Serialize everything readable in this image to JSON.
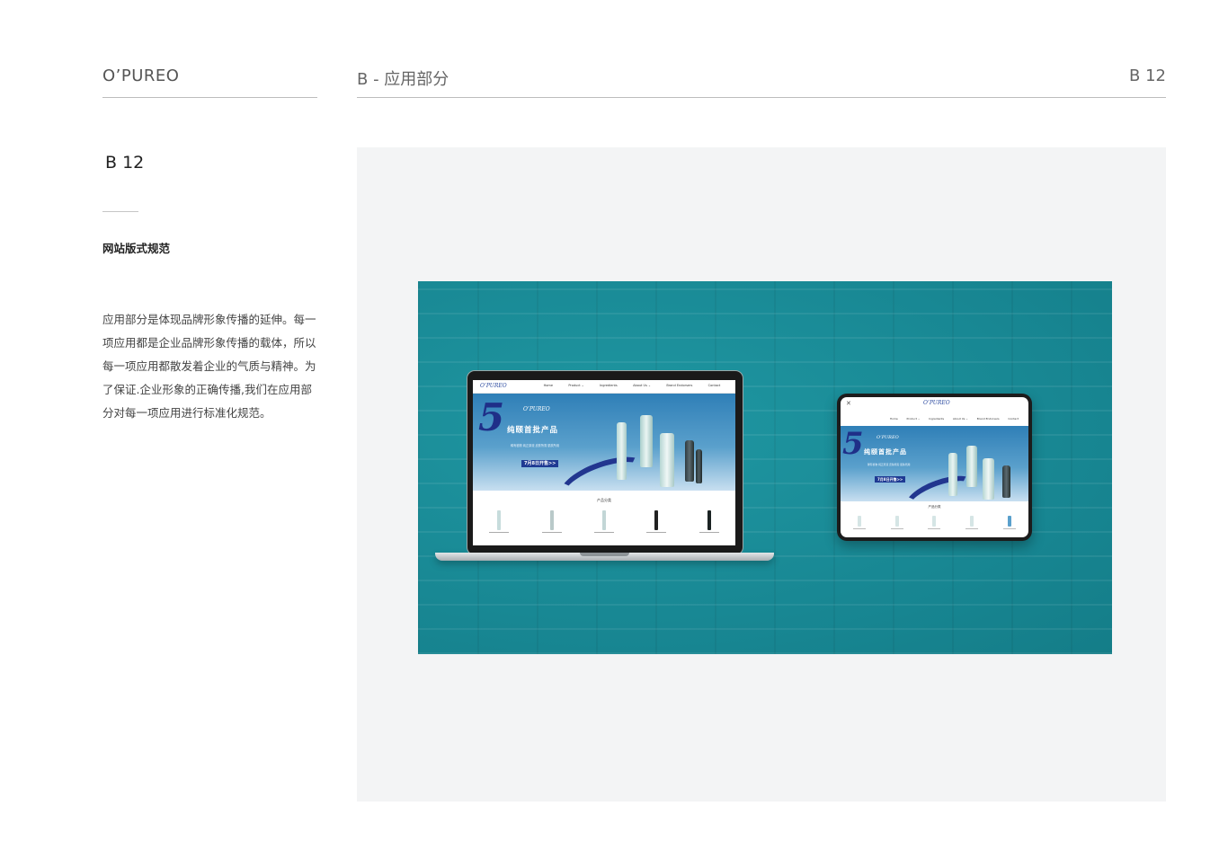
{
  "header": {
    "brand": "O’PUREO",
    "section_title": "B - 应用部分",
    "page_number": "B 12"
  },
  "sidebar": {
    "code": "B 12",
    "subtitle": "网站版式规范",
    "description": "应用部分是体现品牌形象传播的延伸。每一项应用都是企业品牌形象传播的载体，所以每一项应用都散发着企业的气质与精神。为了保证.企业形象的正确传播,我们在应用部分对每一项应用进行标准化规范。"
  },
  "mockup": {
    "background_color": "#1a8b96",
    "website": {
      "logo": "O’PUREO",
      "nav_links": [
        "Home",
        "Product ⌄",
        "Ingredients",
        "About Us ⌄",
        "Brand Endorsers",
        "Contact"
      ],
      "hero_brand": "O’PUREO",
      "hero_title": "纯颐首批产品",
      "hero_tagline": "稀有植物  纯正原液  皮肤所需  肌肤所用",
      "hero_button": "7月8日开售>>",
      "category_title": "产品分类"
    }
  }
}
